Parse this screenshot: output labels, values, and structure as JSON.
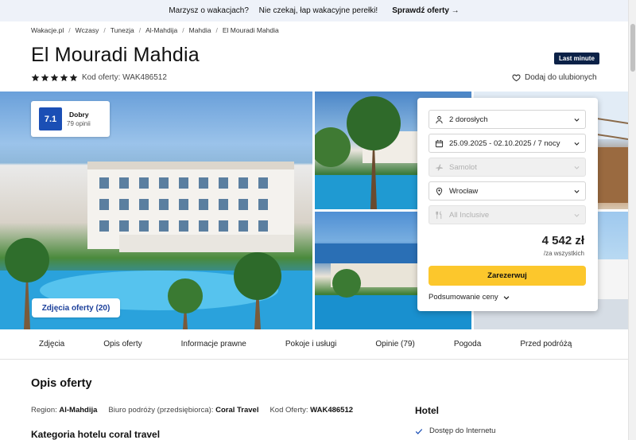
{
  "promo": {
    "text": "Marzysz o wakacjach?  Nie czekaj, łap wakacyjne perełki! ",
    "cta": "Sprawdź oferty",
    "cta_arrow": "→"
  },
  "breadcrumbs": [
    "Wakacje.pl",
    "Wczasy",
    "Tunezja",
    "Al-Mahdija",
    "Mahdia",
    "El Mouradi Mahdia"
  ],
  "breadcrumb_separator": "/",
  "hotel": {
    "name": "El Mouradi Mahdia",
    "badge": "Last minute",
    "stars": 5,
    "offer_code": "Kod oferty: WAK486512",
    "favorite": "Dodaj do ulubionych"
  },
  "rating": {
    "score": "7.1",
    "label": "Dobry",
    "count": "79 opinii"
  },
  "photos_button": "Zdjęcia oferty (20)",
  "booking": {
    "travelers": "2 dorosłych",
    "dates": "25.09.2025 - 02.10.2025 / 7 nocy",
    "transport": "Samolot",
    "departure": "Wrocław",
    "board": "All Inclusive",
    "price": "4 542 zł",
    "price_note": "/za wszystkich",
    "reserve": "Zarezerwuj",
    "summary": "Podsumowanie ceny"
  },
  "tabs": [
    "Zdjęcia",
    "Opis oferty",
    "Informacje prawne",
    "Pokoje i usługi",
    "Opinie (79)",
    "Pogoda",
    "Przed podróżą"
  ],
  "description": {
    "title": "Opis oferty",
    "region_label": "Region:",
    "region_value": "Al-Mahdija",
    "agency_label": "Biuro podróży (przedsiębiorca):",
    "agency_value": "Coral Travel",
    "code_label": "Kod Oferty:",
    "code_value": "WAK486512",
    "category_title": "Kategoria hotelu coral travel"
  },
  "hotel_section": {
    "title": "Hotel",
    "amenity": "Dostęp do Internetu"
  },
  "colors": {
    "accent": "#1b4fb5",
    "badge": "#0b2147",
    "reserve": "#fcc72c",
    "star": "#1c1c1c"
  },
  "icons": [
    "star-icon",
    "heart-icon",
    "person-icon",
    "calendar-icon",
    "plane-icon",
    "location-icon",
    "meal-icon",
    "chevron-down-icon",
    "check-icon",
    "arrow-right-icon"
  ]
}
